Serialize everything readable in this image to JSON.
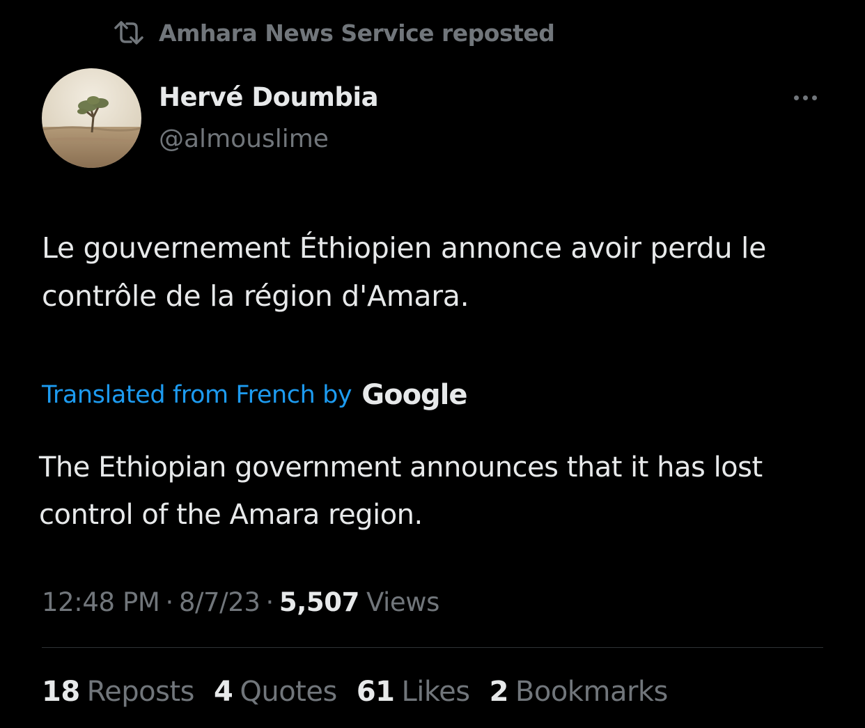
{
  "repost_banner": {
    "text": "Amhara News Service reposted",
    "icon": "repost-icon"
  },
  "author": {
    "name": "Hervé Doumbia",
    "handle": "@almouslime",
    "avatar": "avatar-landscape-tree"
  },
  "more_menu": {
    "icon": "more-horizontal-icon"
  },
  "tweet": {
    "original_text": "Le gouvernement Éthiopien annonce avoir perdu le contrôle de la région d'Amara.",
    "translation_label": "Translated from French by",
    "translation_provider": "Google",
    "translated_text": "The Ethiopian government announces that it has lost control of the Amara region."
  },
  "meta": {
    "time": "12:48 PM",
    "date": "8/7/23",
    "views_count": "5,507",
    "views_label": "Views"
  },
  "stats": [
    {
      "count": "18",
      "label": "Reposts"
    },
    {
      "count": "4",
      "label": "Quotes"
    },
    {
      "count": "61",
      "label": "Likes"
    },
    {
      "count": "2",
      "label": "Bookmarks"
    }
  ],
  "colors": {
    "background": "#000000",
    "primary_text": "#e7e9ea",
    "secondary_text": "#71767b",
    "link": "#1d9bf0",
    "divider": "#2f3336"
  }
}
